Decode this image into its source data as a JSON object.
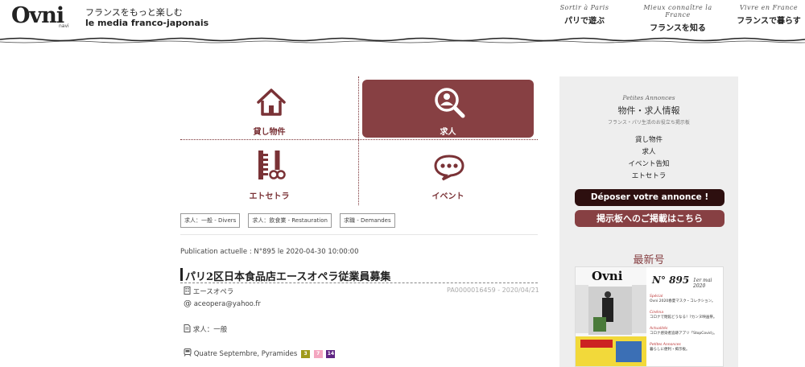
{
  "header": {
    "logo": "Ovni",
    "logo_sub": "navi",
    "tagline_jp": "フランスをもっと楽しむ",
    "tagline_fr": "le media franco-japonais",
    "nav": [
      {
        "fr": "Sortir à Paris",
        "jp": "パリで遊ぶ"
      },
      {
        "fr": "Mieux connaître la France",
        "jp": "フランスを知る"
      },
      {
        "fr": "Vivre en France",
        "jp": "フランスで暮らす"
      }
    ]
  },
  "categories": [
    {
      "label": "貸し物件",
      "icon": "house-icon",
      "active": false
    },
    {
      "label": "求人",
      "icon": "search-person-icon",
      "active": true
    },
    {
      "label": "エトセトラ",
      "icon": "comb-scissors-icon",
      "active": false
    },
    {
      "label": "イベント",
      "icon": "speech-bubble-icon",
      "active": false
    }
  ],
  "tags": [
    "求人：一般 - Divers",
    "求人：飲食業 - Restauration",
    "求職 - Demandes"
  ],
  "listing": {
    "publication": "Publication actuelle : N°895 le 2020-04-30 10:00:00",
    "title": "パリ2区日本食品店エースオペラ従業員募集",
    "company": "エースオペラ",
    "ref": "PA0000016459 - 2020/04/21",
    "email": "aceopera@yahoo.fr",
    "category": "求人：一般",
    "metro_station": "Quatre Septembre, Pyramides",
    "metro_lines": [
      {
        "num": "3",
        "color": "#a09a1b"
      },
      {
        "num": "7",
        "color": "#f4a6c0"
      },
      {
        "num": "14",
        "color": "#5f2583"
      }
    ]
  },
  "sidebar": {
    "pa_label": "Petites Annonces",
    "title": "物件・求人情報",
    "subtitle": "フランス・パリ生活のお役立ち掲示板",
    "links": [
      "貸し物件",
      "求人",
      "イベント告知",
      "エトセトラ"
    ],
    "btn_deposit": "Déposer votre annonce !",
    "btn_jp": "掲示板へのご掲載はこちら",
    "latest": "最新号",
    "magazine": {
      "logo": "Ovni",
      "number": "N° 895",
      "date": "1er mai 2020",
      "items": [
        {
          "head": "Spécial",
          "text": "Ovni 2020春夏マスク・コレクション。"
        },
        {
          "head": "Cinéma",
          "text": "コロナで閉館どうなる！?カンヌ映画祭。"
        },
        {
          "head": "Actualités",
          "text": "コロナ感染者追跡アプリ「StopCovid」。"
        },
        {
          "head": "Petites Annonces",
          "text": "暮らしに便利・掲示板。"
        }
      ]
    }
  },
  "colors": {
    "accent": "#874043",
    "dark": "#2d0f0f"
  }
}
